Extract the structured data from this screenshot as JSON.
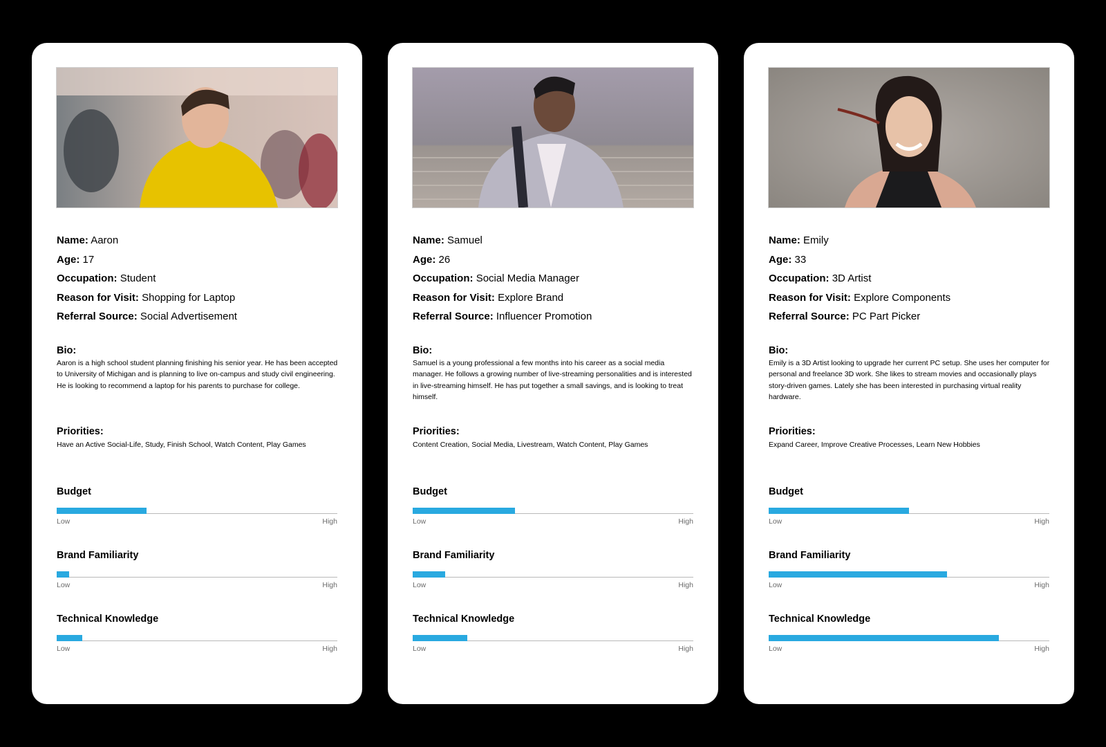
{
  "personas": [
    {
      "fields": [
        {
          "label": "Name:",
          "value": "Aaron"
        },
        {
          "label": "Age:",
          "value": "17"
        },
        {
          "label": "Occupation:",
          "value": "Student"
        },
        {
          "label": "Reason for Visit:",
          "value": "Shopping for Laptop"
        },
        {
          "label": "Referral Source:",
          "value": "Social Advertisement"
        }
      ],
      "bio_title": "Bio:",
      "bio": "Aaron is a high school student planning finishing his senior year. He has been accepted to University of Michigan and is planning to live on-campus and study civil engineering. He is looking to recommend a laptop for his parents to purchase for college.",
      "priorities_title": "Priorities:",
      "priorities": "Have an Active Social-Life, Study, Finish School, Watch Content, Play Games",
      "meters": [
        {
          "title": "Budget",
          "level": 0.32,
          "low": "Low",
          "high": "High"
        },
        {
          "title": "Brand Familiarity",
          "level": 0.045,
          "low": "Low",
          "high": "High"
        },
        {
          "title": "Technical Knowledge",
          "level": 0.09,
          "low": "Low",
          "high": "High"
        }
      ]
    },
    {
      "fields": [
        {
          "label": "Name:",
          "value": "Samuel"
        },
        {
          "label": "Age:",
          "value": "26"
        },
        {
          "label": "Occupation:",
          "value": "Social Media Manager"
        },
        {
          "label": "Reason for Visit:",
          "value": "Explore Brand"
        },
        {
          "label": "Referral Source:",
          "value": "Influencer Promotion"
        }
      ],
      "bio_title": "Bio:",
      "bio": "Samuel is a young professional a few months into his career as a social media manager. He follows a growing number of live-streaming personalities and is interested in live-streaming himself. He has put together a small savings, and is looking to treat himself.",
      "priorities_title": "Priorities:",
      "priorities": "Content Creation, Social Media, Livestream, Watch Content, Play Games",
      "meters": [
        {
          "title": "Budget",
          "level": 0.365,
          "low": "Low",
          "high": "High"
        },
        {
          "title": "Brand Familiarity",
          "level": 0.115,
          "low": "Low",
          "high": "High"
        },
        {
          "title": "Technical Knowledge",
          "level": 0.195,
          "low": "Low",
          "high": "High"
        }
      ]
    },
    {
      "fields": [
        {
          "label": "Name:",
          "value": "Emily"
        },
        {
          "label": "Age:",
          "value": "33"
        },
        {
          "label": "Occupation:",
          "value": "3D Artist"
        },
        {
          "label": "Reason for Visit:",
          "value": "Explore Components"
        },
        {
          "label": "Referral Source:",
          "value": "PC Part Picker"
        }
      ],
      "bio_title": "Bio:",
      "bio": "Emily is a 3D Artist looking to upgrade her current PC setup. She uses her computer for personal and freelance 3D work. She likes to stream movies and occasionally plays story-driven games. Lately she has been interested in purchasing virtual reality hardware.",
      "priorities_title": "Priorities:",
      "priorities": "Expand Career, Improve Creative Processes, Learn New Hobbies",
      "meters": [
        {
          "title": "Budget",
          "level": 0.5,
          "low": "Low",
          "high": "High"
        },
        {
          "title": "Brand Familiarity",
          "level": 0.635,
          "low": "Low",
          "high": "High"
        },
        {
          "title": "Technical Knowledge",
          "level": 0.82,
          "low": "Low",
          "high": "High"
        }
      ]
    }
  ],
  "colors": {
    "background": "#000000",
    "card": "#ffffff",
    "meter_fill": "#29a9e0",
    "meter_track": "#b9b9b9"
  }
}
